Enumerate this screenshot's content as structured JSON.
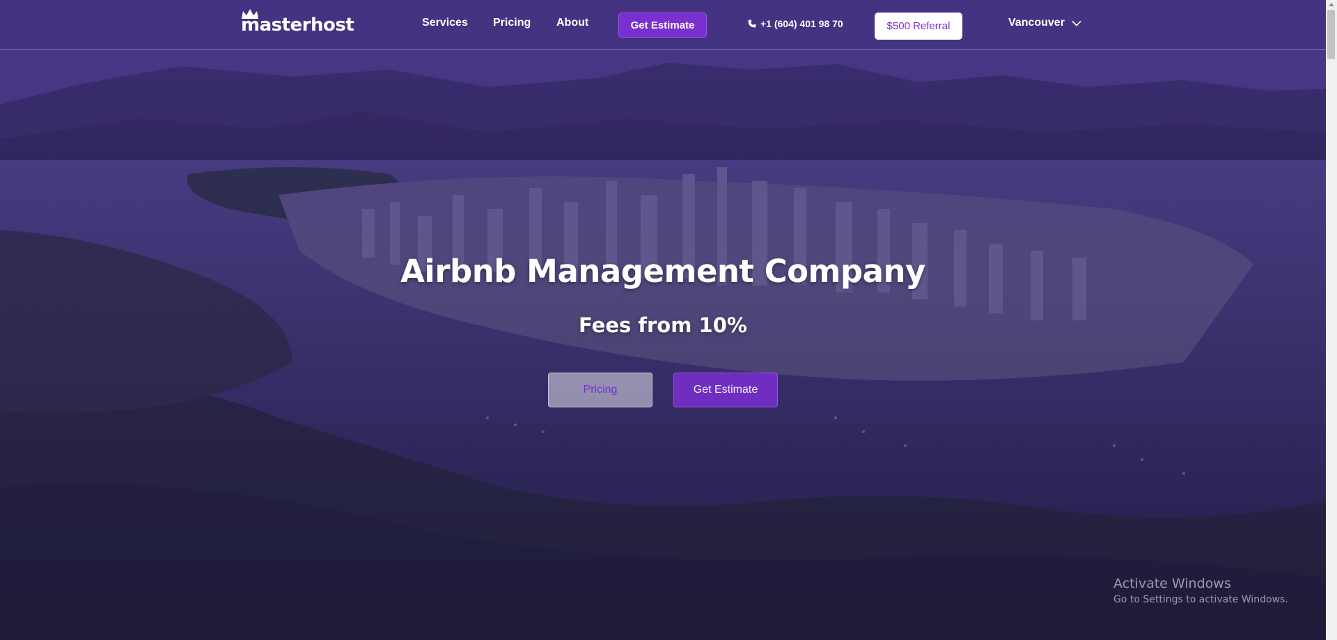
{
  "brand": {
    "logo_text": "masterhost"
  },
  "nav": {
    "items": [
      {
        "label": "Services"
      },
      {
        "label": "Pricing"
      },
      {
        "label": "About"
      }
    ],
    "estimate_label": "Get Estimate",
    "phone": "+1 (604) 401 98 70",
    "referral_label": "$500 Referral",
    "city": "Vancouver"
  },
  "hero": {
    "title": "Airbnb Management Company",
    "subtitle": "Fees from 10%",
    "pricing_button": "Pricing",
    "estimate_button": "Get Estimate"
  },
  "watermark": {
    "title": "Activate Windows",
    "subtitle": "Go to Settings to activate Windows."
  },
  "icons": {
    "logo": "crown-icon",
    "phone": "phone-icon",
    "dropdown": "chevron-down-icon"
  },
  "colors": {
    "accent": "#7a2fd1",
    "overlay": "#3a2678",
    "text": "#ffffff"
  }
}
